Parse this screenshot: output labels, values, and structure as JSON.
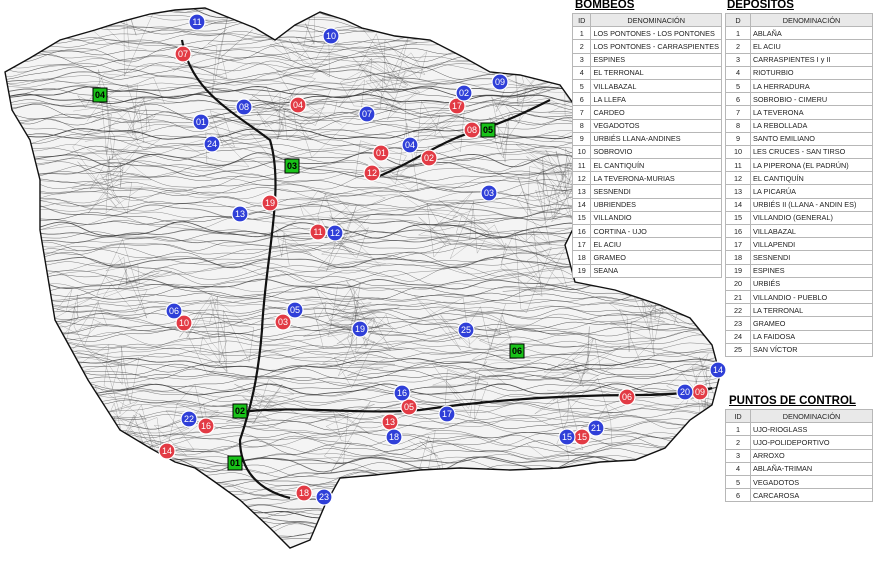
{
  "legend": {
    "bombeos": {
      "title": "BOMBEOS",
      "col_id": "ID",
      "col_name": "DENOMINACIÓN",
      "rows": [
        {
          "id": "1",
          "name": "LOS PONTONES - LOS PONTONES"
        },
        {
          "id": "2",
          "name": "LOS PONTONES - CARRASPIENTES"
        },
        {
          "id": "3",
          "name": "ESPINES"
        },
        {
          "id": "4",
          "name": "EL TERRONAL"
        },
        {
          "id": "5",
          "name": "VILLABAZAL"
        },
        {
          "id": "6",
          "name": "LA LLEFA"
        },
        {
          "id": "7",
          "name": "CARDEO"
        },
        {
          "id": "8",
          "name": "VEGADOTOS"
        },
        {
          "id": "9",
          "name": "URBIÉS LLANA-ANDINES"
        },
        {
          "id": "10",
          "name": "SOBROVIO"
        },
        {
          "id": "11",
          "name": "EL CANTIQUÍN"
        },
        {
          "id": "12",
          "name": "LA TEVERONA-MURIAS"
        },
        {
          "id": "13",
          "name": "SESNENDI"
        },
        {
          "id": "14",
          "name": "UBRIENDES"
        },
        {
          "id": "15",
          "name": "VILLANDIO"
        },
        {
          "id": "16",
          "name": "CORTINA - UJO"
        },
        {
          "id": "17",
          "name": "EL ACIU"
        },
        {
          "id": "18",
          "name": "GRAMEO"
        },
        {
          "id": "19",
          "name": "SEANA"
        }
      ]
    },
    "depositos": {
      "title": "DEPÓSITOS",
      "col_id": "D",
      "col_name": "DENOMINACIÓN",
      "rows": [
        {
          "id": "1",
          "name": "ABLAÑA"
        },
        {
          "id": "2",
          "name": "EL ACIU"
        },
        {
          "id": "3",
          "name": "CARRASPIENTES I y II"
        },
        {
          "id": "4",
          "name": "RIOTURBIO"
        },
        {
          "id": "5",
          "name": "LA HERRADURA"
        },
        {
          "id": "6",
          "name": "SOBROBIO - CIMERU"
        },
        {
          "id": "7",
          "name": "LA TEVERONA"
        },
        {
          "id": "8",
          "name": "LA REBOLLADA"
        },
        {
          "id": "9",
          "name": "SANTO EMILIANO"
        },
        {
          "id": "10",
          "name": "LES CRUCES - SAN TIRSO"
        },
        {
          "id": "11",
          "name": "LA PIPERONA (EL PADRÚN)"
        },
        {
          "id": "12",
          "name": "EL CANTIQUÍN"
        },
        {
          "id": "13",
          "name": "LA PICARÚA"
        },
        {
          "id": "14",
          "name": "URBIÉS II (LLANA - ANDIN ES)"
        },
        {
          "id": "15",
          "name": "VILLANDIO (GENERAL)"
        },
        {
          "id": "16",
          "name": "VILLABAZAL"
        },
        {
          "id": "17",
          "name": "VILLAPENDI"
        },
        {
          "id": "18",
          "name": "SESNENDI"
        },
        {
          "id": "19",
          "name": "ESPINES"
        },
        {
          "id": "20",
          "name": "URBIÉS"
        },
        {
          "id": "21",
          "name": "VILLANDIO - PUEBLO"
        },
        {
          "id": "22",
          "name": "LA TERRONAL"
        },
        {
          "id": "23",
          "name": "GRAMEO"
        },
        {
          "id": "24",
          "name": "LA FAIDOSA"
        },
        {
          "id": "25",
          "name": "SAN VÍCTOR"
        }
      ]
    },
    "control": {
      "title": "PUNTOS DE CONTROL",
      "col_id": "ID",
      "col_name": "DENOMINACIÓN",
      "rows": [
        {
          "id": "1",
          "name": "UJO-RIOGLASS"
        },
        {
          "id": "2",
          "name": "UJO-POLIDEPORTIVO"
        },
        {
          "id": "3",
          "name": "ARROXO"
        },
        {
          "id": "4",
          "name": "ABLAÑA-TRIMAN"
        },
        {
          "id": "5",
          "name": "VEGADOTOS"
        },
        {
          "id": "6",
          "name": "CARCAROSA"
        }
      ]
    }
  },
  "colors": {
    "bombeo": "#e23a44",
    "deposito": "#2f3fd8",
    "control": "#19c219",
    "terrain": "#3a3a3a"
  },
  "markers": {
    "bombeos": [
      "01",
      "02",
      "03",
      "04",
      "05",
      "06",
      "07",
      "08",
      "09",
      "10",
      "11",
      "12",
      "13",
      "14",
      "15",
      "16",
      "17",
      "18",
      "19"
    ],
    "depositos": [
      "01",
      "02",
      "03",
      "04",
      "05",
      "06",
      "07",
      "08",
      "09",
      "10",
      "11",
      "12",
      "13",
      "14",
      "15",
      "16",
      "17",
      "18",
      "19",
      "20",
      "21",
      "22",
      "23",
      "24",
      "25"
    ],
    "control": [
      "01",
      "02",
      "03",
      "04",
      "05",
      "06"
    ]
  }
}
